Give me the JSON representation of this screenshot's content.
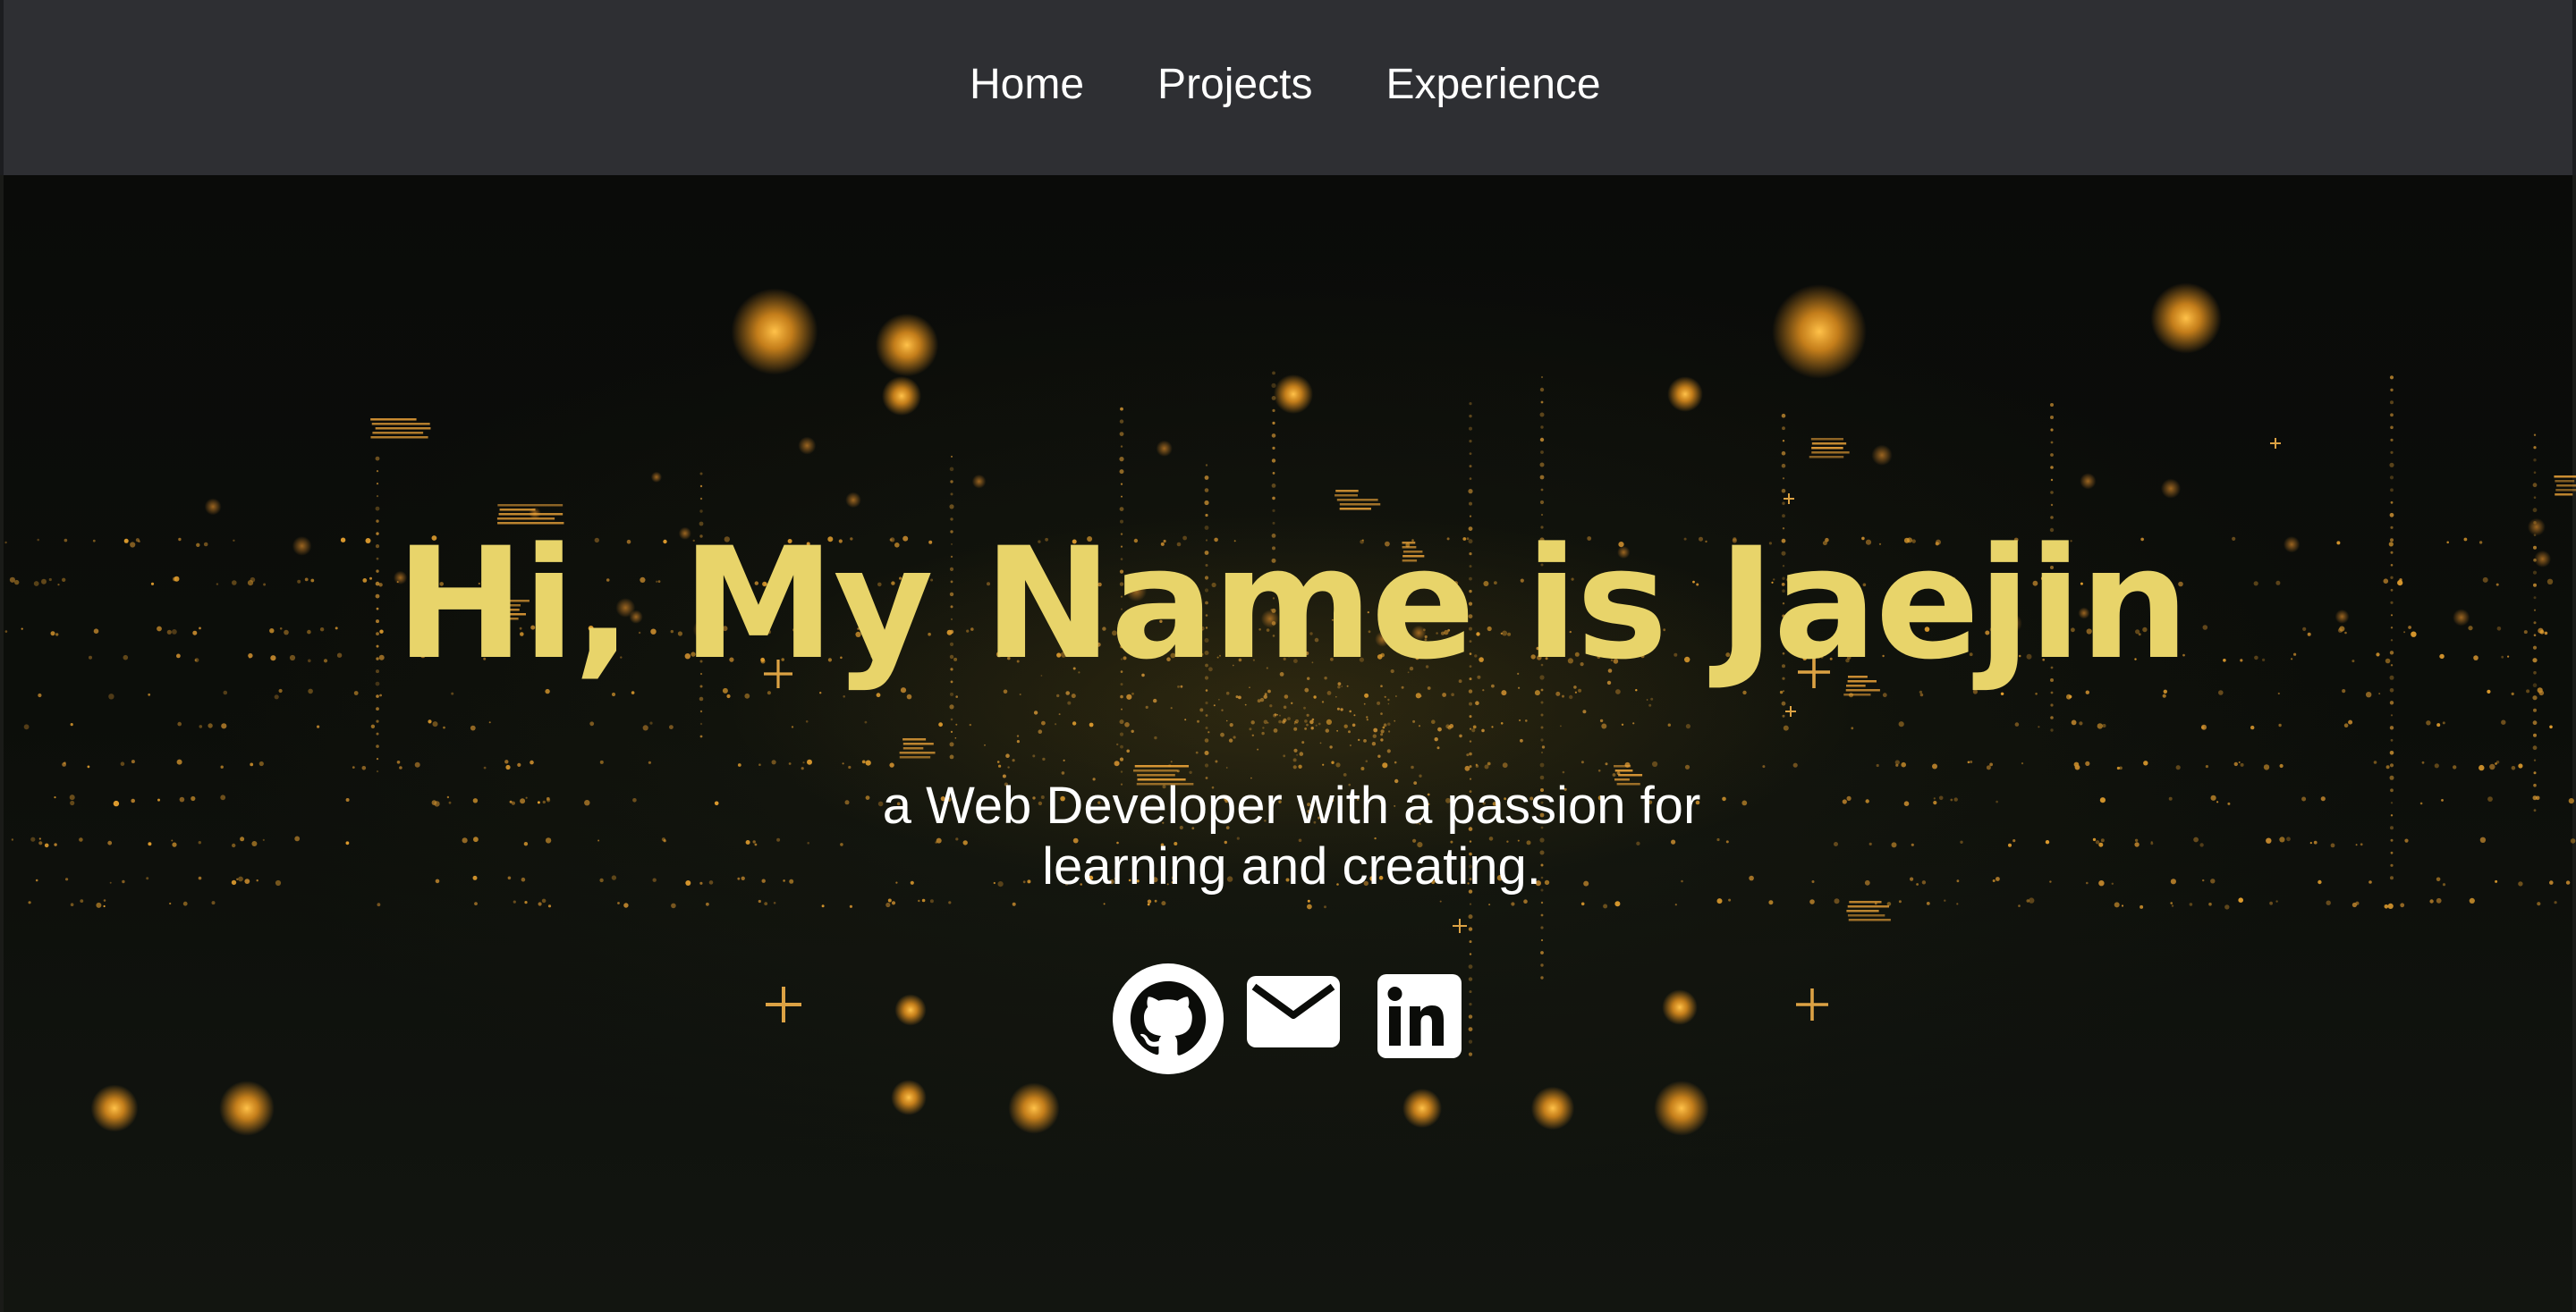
{
  "nav": {
    "items": [
      {
        "label": "Home"
      },
      {
        "label": "Projects"
      },
      {
        "label": "Experience"
      }
    ]
  },
  "hero": {
    "title": "Hi, My Name is Jaejin",
    "subtitle_line1": "a Web Developer with a passion for",
    "subtitle_line2": "learning and creating.",
    "socials": [
      {
        "icon": "github-icon"
      },
      {
        "icon": "email-icon"
      },
      {
        "icon": "linkedin-icon"
      }
    ]
  },
  "colors": {
    "nav_bg": "#2e2f33",
    "title": "#e8d46a",
    "text": "#ffffff",
    "background": "#0b0c09",
    "sparkle": "#f5a623"
  }
}
